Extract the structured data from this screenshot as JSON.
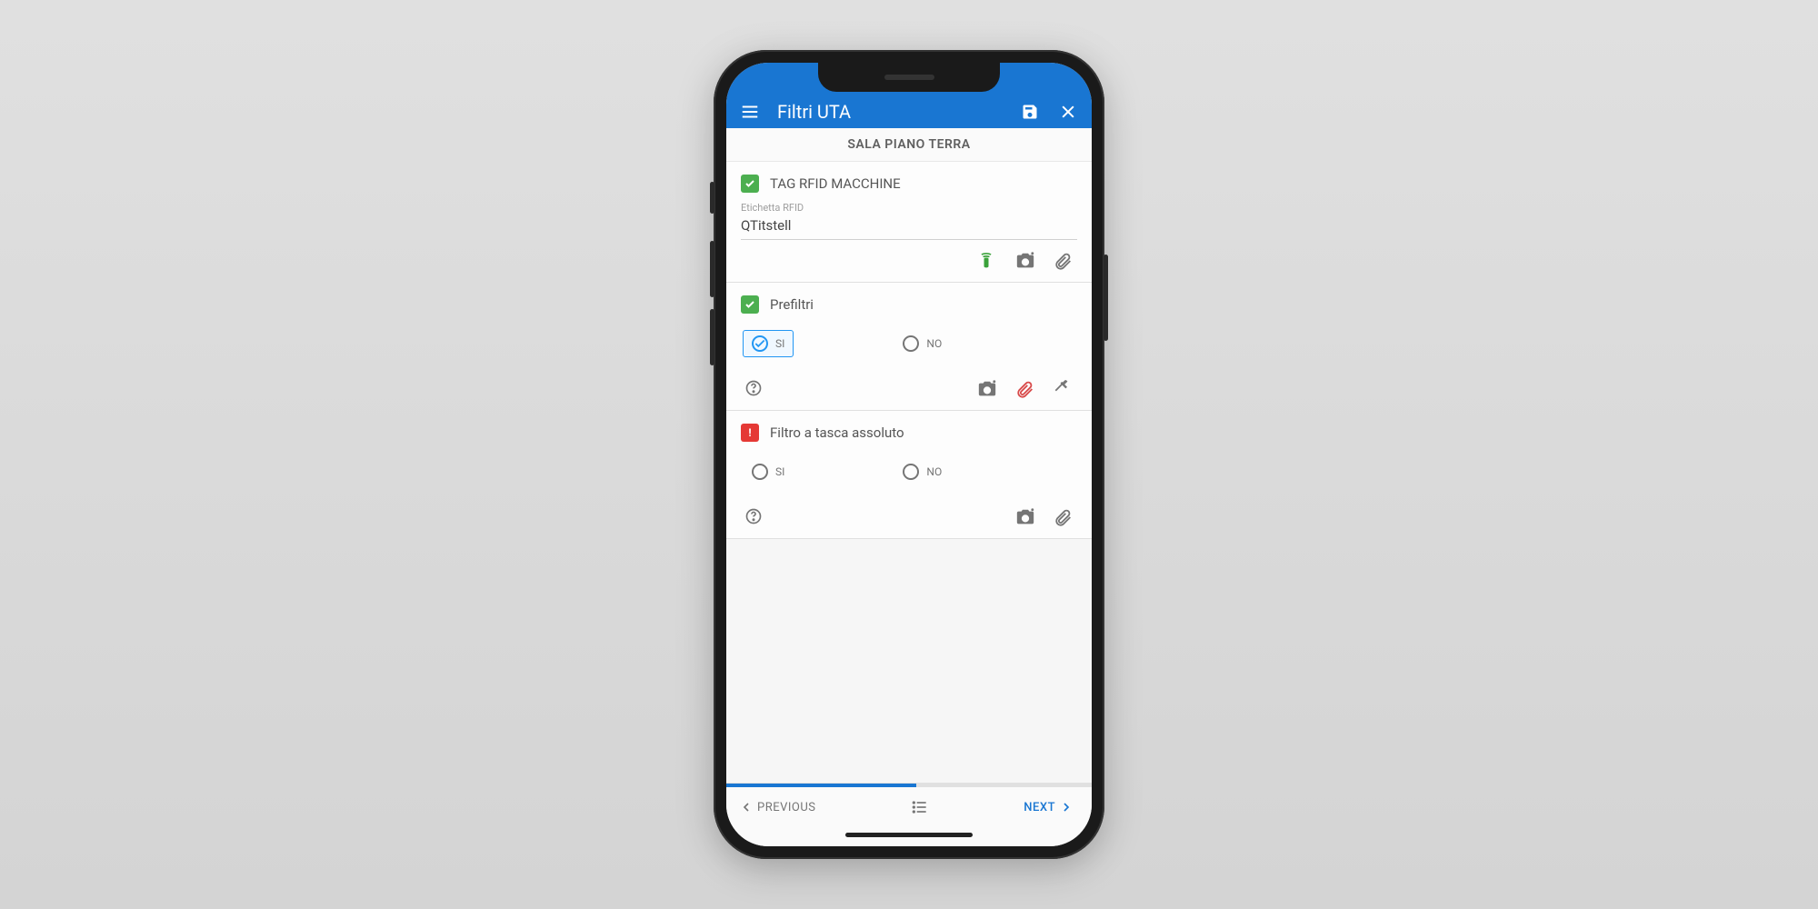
{
  "appbar": {
    "title": "Filtri UTA"
  },
  "subheader": "SALA PIANO TERRA",
  "sections": {
    "rfid": {
      "title": "TAG RFID MACCHINE",
      "field_label": "Etichetta RFID",
      "field_value": "QTitstell"
    },
    "prefiltri": {
      "title": "Prefiltri",
      "option_si": "SI",
      "option_no": "NO"
    },
    "filtro_tasca": {
      "title": "Filtro a tasca assoluto",
      "option_si": "SI",
      "option_no": "NO"
    }
  },
  "footer": {
    "previous": "PREVIOUS",
    "next": "NEXT"
  }
}
